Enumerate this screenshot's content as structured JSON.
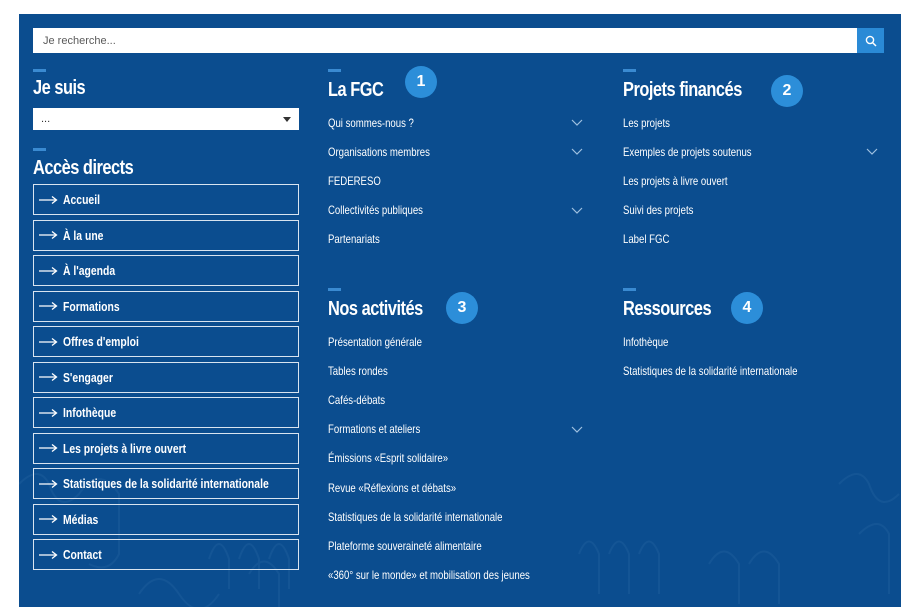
{
  "search": {
    "placeholder": "Je recherche..."
  },
  "je_suis": {
    "title": "Je suis",
    "select_value": "..."
  },
  "acces": {
    "title": "Accès directs",
    "items": [
      "Accueil",
      "À la une",
      "À l'agenda",
      "Formations",
      "Offres d'emploi",
      "S'engager",
      "Infothèque",
      "Les projets à livre ouvert",
      "Statistiques de la solidarité internationale",
      "Médias",
      "Contact"
    ]
  },
  "la_fgc": {
    "title": "La FGC",
    "badge": "1",
    "items": [
      {
        "label": "Qui sommes-nous ?",
        "has_submenu": true
      },
      {
        "label": "Organisations membres",
        "has_submenu": true
      },
      {
        "label": "FEDERESO",
        "has_submenu": false
      },
      {
        "label": "Collectivités publiques",
        "has_submenu": true
      },
      {
        "label": "Partenariats",
        "has_submenu": false
      }
    ]
  },
  "projets": {
    "title": "Projets financés",
    "badge": "2",
    "items": [
      {
        "label": "Les projets",
        "has_submenu": false
      },
      {
        "label": "Exemples de projets soutenus",
        "has_submenu": true
      },
      {
        "label": "Les projets à livre ouvert",
        "has_submenu": false
      },
      {
        "label": "Suivi des projets",
        "has_submenu": false
      },
      {
        "label": "Label FGC",
        "has_submenu": false
      }
    ]
  },
  "activites": {
    "title": "Nos activités",
    "badge": "3",
    "items": [
      {
        "label": "Présentation générale",
        "has_submenu": false
      },
      {
        "label": "Tables rondes",
        "has_submenu": false
      },
      {
        "label": "Cafés-débats",
        "has_submenu": false
      },
      {
        "label": "Formations et ateliers",
        "has_submenu": true
      },
      {
        "label": "Émissions «Esprit solidaire»",
        "has_submenu": false
      },
      {
        "label": "Revue «Réflexions et débats»",
        "has_submenu": false
      },
      {
        "label": "Statistiques de la solidarité internationale",
        "has_submenu": false
      },
      {
        "label": "Plateforme souveraineté alimentaire",
        "has_submenu": false
      },
      {
        "label": "«360° sur le monde» et mobilisation des jeunes",
        "has_submenu": false
      }
    ]
  },
  "ressources": {
    "title": "Ressources",
    "badge": "4",
    "items": [
      {
        "label": "Infothèque",
        "has_submenu": false
      },
      {
        "label": "Statistiques de la solidarité internationale",
        "has_submenu": false
      }
    ]
  },
  "colors": {
    "panel_bg": "#0b4d8f",
    "accent": "#2c8ed9",
    "search_button": "#2a8ad6"
  }
}
